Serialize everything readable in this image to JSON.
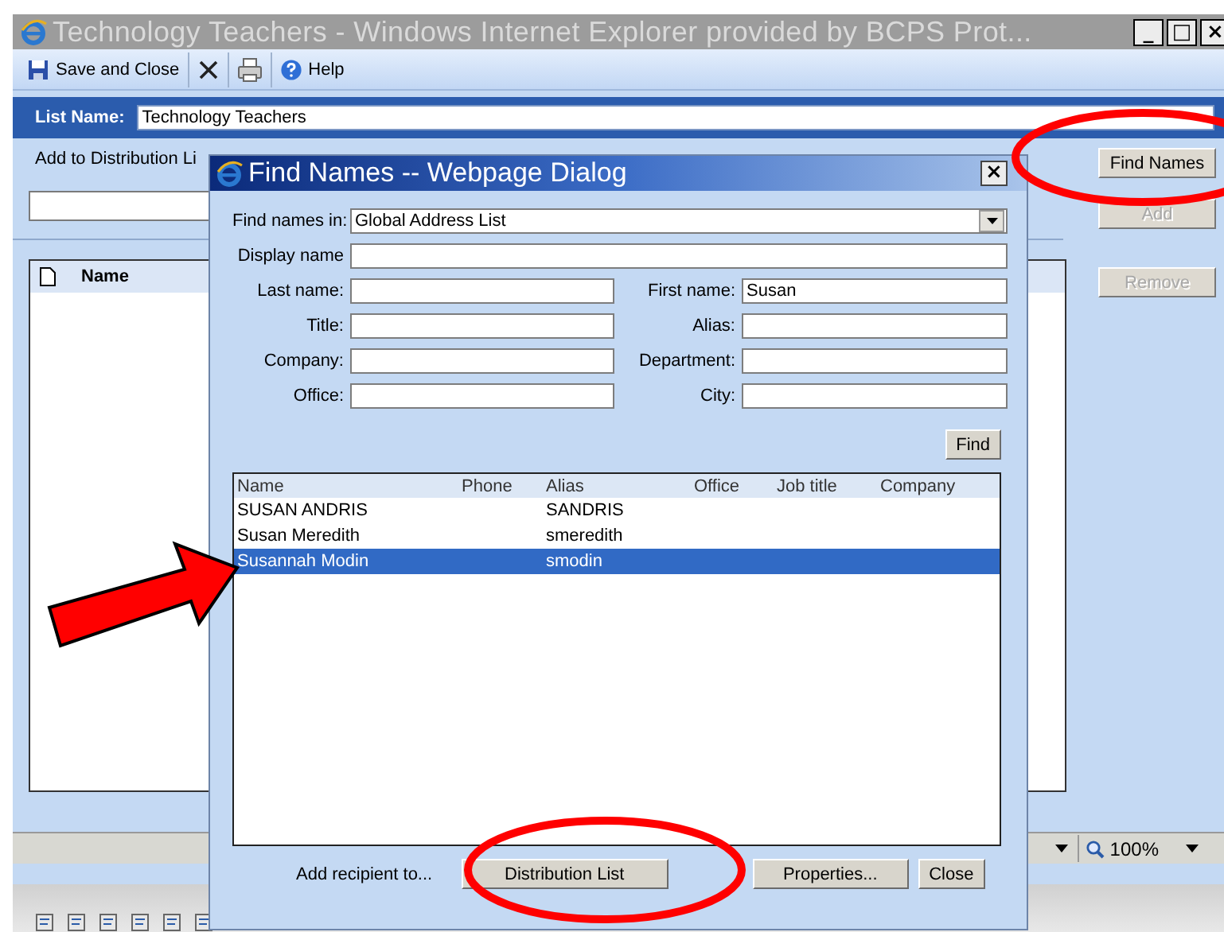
{
  "window": {
    "title": "Technology Teachers - Windows Internet Explorer provided by BCPS Prot...",
    "controls": [
      {
        "kind": "minimize",
        "label": "_"
      },
      {
        "kind": "maximize",
        "label": "□"
      },
      {
        "kind": "close",
        "label": "×"
      }
    ]
  },
  "toolbar": [
    {
      "kind": "save",
      "label": "Save and Close"
    },
    {
      "kind": "delete"
    },
    {
      "kind": "print"
    },
    {
      "kind": "help",
      "label": "Help"
    }
  ],
  "list_name": {
    "label": "List Name:",
    "value": "Technology Teachers"
  },
  "add_to": {
    "label": "Add to Distribution Li"
  },
  "side_buttons": [
    {
      "label": "Find Names",
      "disabled": false
    },
    {
      "label": "Add",
      "disabled": true
    },
    {
      "label": "Remove",
      "disabled": true
    }
  ],
  "members": {
    "columns": [
      "Name"
    ]
  },
  "status_bar": {
    "zoom": "100%"
  },
  "dialog": {
    "title": "Find Names -- Webpage Dialog",
    "find_in": {
      "label": "Find names in:",
      "value": "Global Address List"
    },
    "display_name": {
      "label": "Display name"
    },
    "fields": [
      {
        "label": "Last name:"
      },
      {
        "label": "First name:",
        "value": "Susan"
      },
      {
        "label": "Title:"
      },
      {
        "label": "Alias:"
      },
      {
        "label": "Company:"
      },
      {
        "label": "Department:"
      },
      {
        "label": "Office:"
      },
      {
        "label": "City:"
      }
    ],
    "find_button": "Find",
    "results": {
      "columns": [
        "Name",
        "Phone",
        "Alias",
        "Office",
        "Job title",
        "Company"
      ],
      "rows": [
        {
          "cells": [
            "SUSAN ANDRIS",
            "",
            "SANDRIS",
            "",
            "",
            ""
          ],
          "selected": false
        },
        {
          "cells": [
            "Susan Meredith",
            "",
            "smeredith",
            "",
            "",
            ""
          ],
          "selected": false
        },
        {
          "cells": [
            "Susannah Modin",
            "",
            "smodin",
            "",
            "",
            ""
          ],
          "selected": true
        }
      ]
    },
    "footer_label": "Add recipient to...",
    "buttons": [
      "Distribution List",
      "Properties...",
      "Close"
    ]
  }
}
